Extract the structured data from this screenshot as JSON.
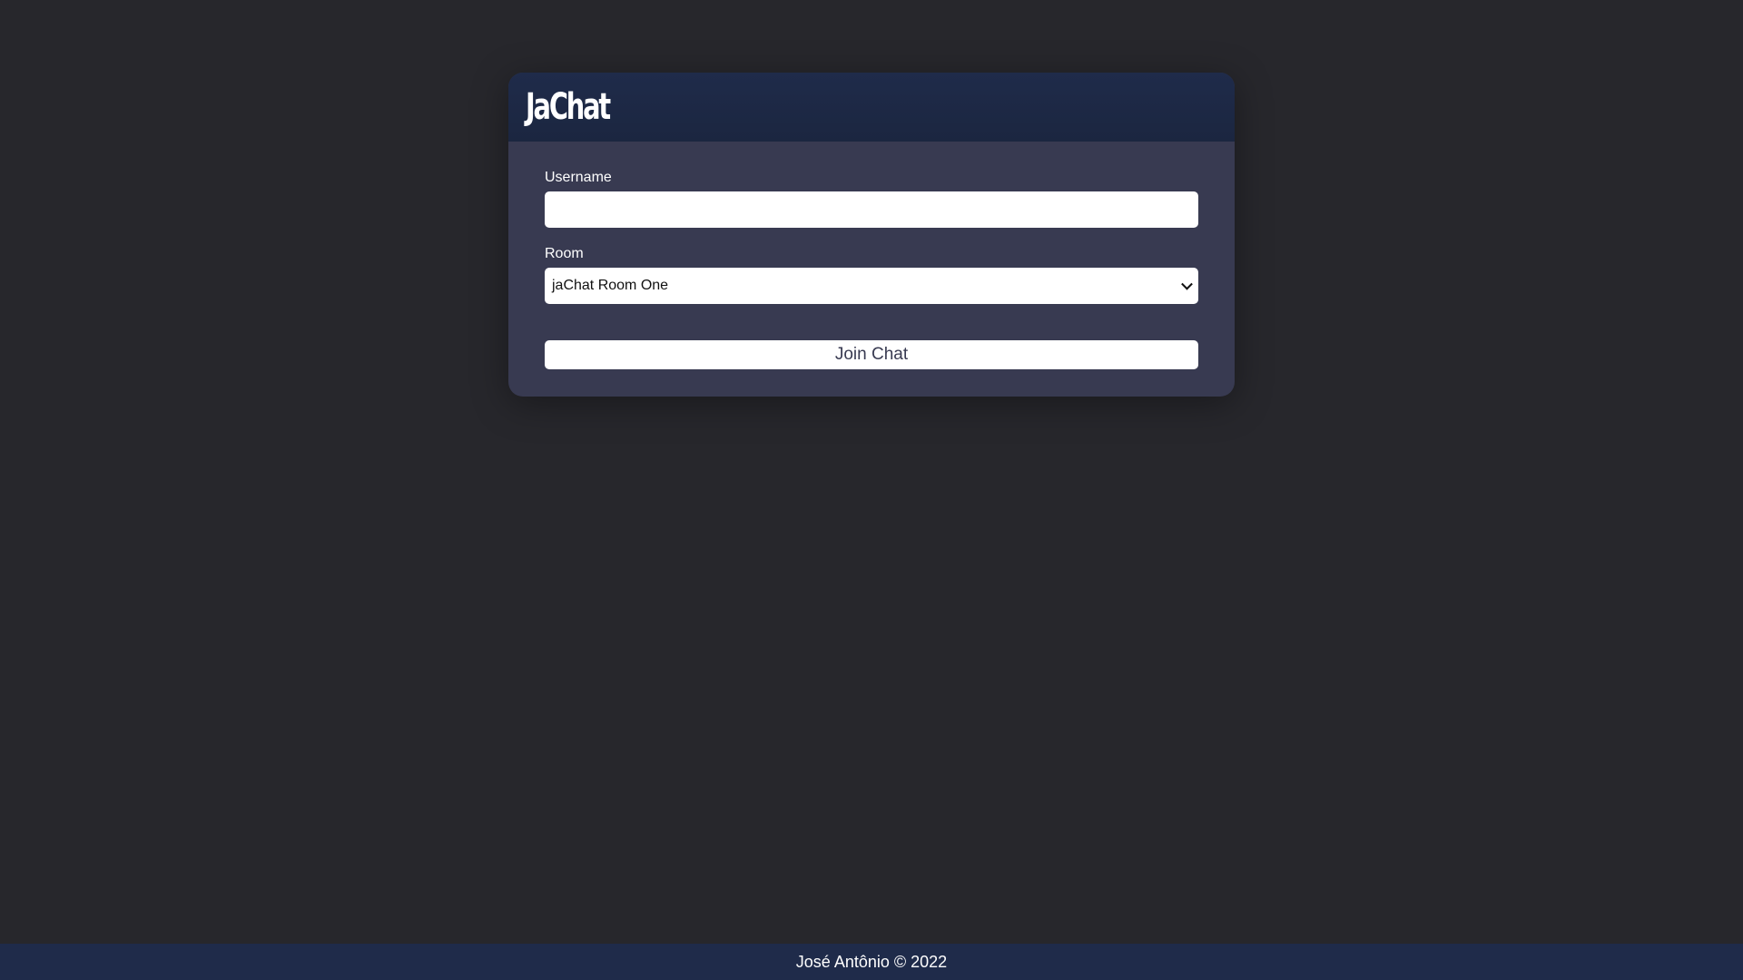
{
  "app": {
    "title": "JaChat"
  },
  "form": {
    "username_label": "Username",
    "username_value": "",
    "room_label": "Room",
    "room_selected": "jaChat Room One",
    "join_button": "Join Chat"
  },
  "footer": {
    "text": "José Antônio © 2022"
  },
  "colors": {
    "background": "#27272c",
    "card": "#383a51",
    "header": "#1f2b4a",
    "footer": "#1f2b4a",
    "button_text": "#383a51"
  }
}
